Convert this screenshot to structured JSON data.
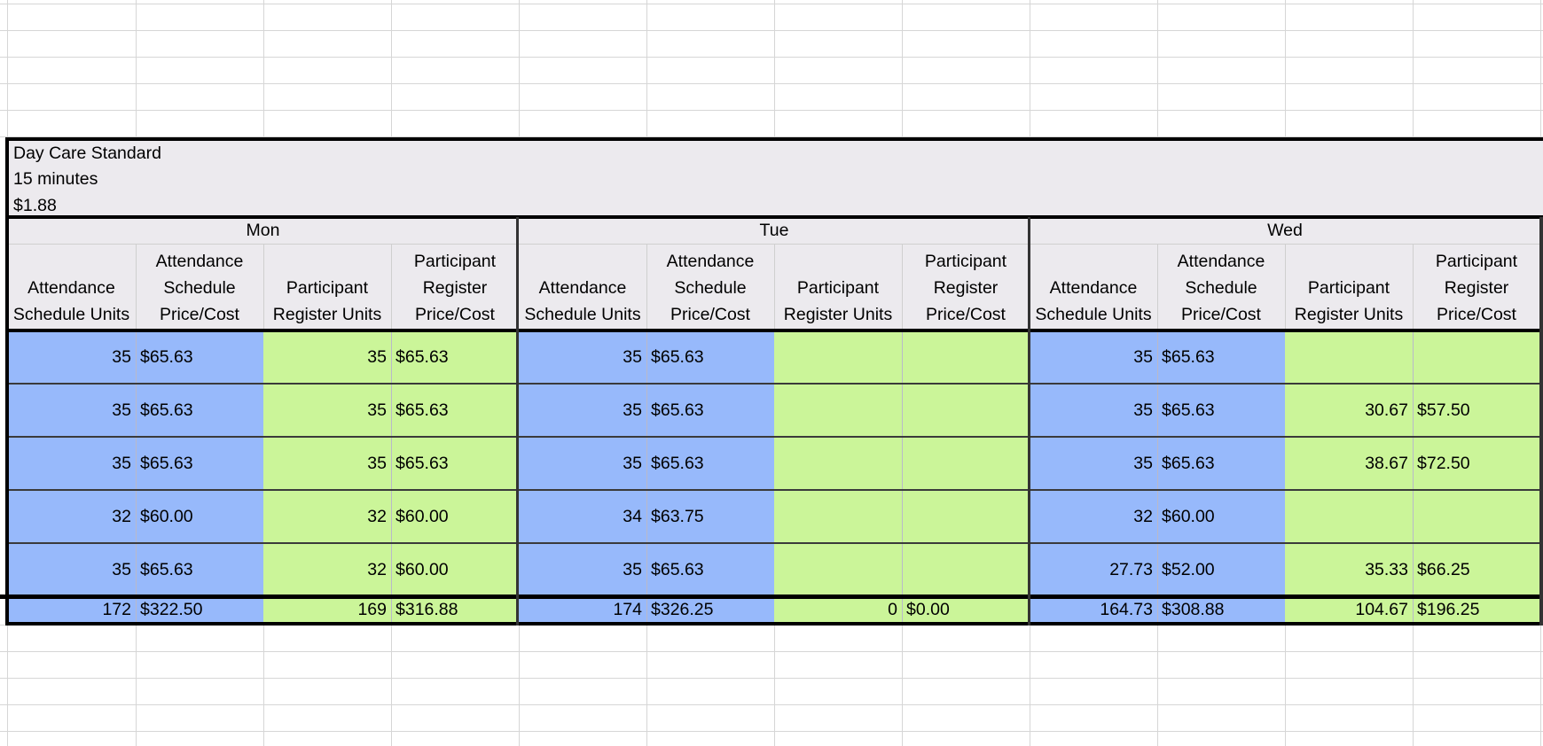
{
  "colors": {
    "gridline": "#d6d6d6",
    "header_fill": "#eceaee",
    "attendance_fill": "#97b9fb",
    "participant_fill": "#cbf599",
    "border": "#000000"
  },
  "service": {
    "name": "Day Care Standard",
    "unit": "15 minutes",
    "rate": "$1.88"
  },
  "columns": [
    {
      "line1": "",
      "line2": "Attendance",
      "line3": "Schedule Units"
    },
    {
      "line1": "Attendance",
      "line2": "Schedule",
      "line3": "Price/Cost"
    },
    {
      "line1": "",
      "line2": "Participant",
      "line3": "Register Units"
    },
    {
      "line1": "Participant",
      "line2": "Register",
      "line3": "Price/Cost"
    }
  ],
  "days": [
    {
      "label": "Mon",
      "rows": [
        [
          "35",
          "$65.63",
          "35",
          "$65.63"
        ],
        [
          "35",
          "$65.63",
          "35",
          "$65.63"
        ],
        [
          "35",
          "$65.63",
          "35",
          "$65.63"
        ],
        [
          "32",
          "$60.00",
          "32",
          "$60.00"
        ],
        [
          "35",
          "$65.63",
          "32",
          "$60.00"
        ]
      ],
      "totals": [
        "172",
        "$322.50",
        "169",
        "$316.88"
      ]
    },
    {
      "label": "Tue",
      "rows": [
        [
          "35",
          "$65.63",
          "",
          ""
        ],
        [
          "35",
          "$65.63",
          "",
          ""
        ],
        [
          "35",
          "$65.63",
          "",
          ""
        ],
        [
          "34",
          "$63.75",
          "",
          ""
        ],
        [
          "35",
          "$65.63",
          "",
          ""
        ]
      ],
      "totals": [
        "174",
        "$326.25",
        "0",
        "$0.00"
      ]
    },
    {
      "label": "Wed",
      "rows": [
        [
          "35",
          "$65.63",
          "",
          ""
        ],
        [
          "35",
          "$65.63",
          "30.67",
          "$57.50"
        ],
        [
          "35",
          "$65.63",
          "38.67",
          "$72.50"
        ],
        [
          "32",
          "$60.00",
          "",
          ""
        ],
        [
          "27.73",
          "$52.00",
          "35.33",
          "$66.25"
        ]
      ],
      "totals": [
        "164.73",
        "$308.88",
        "104.67",
        "$196.25"
      ]
    }
  ]
}
